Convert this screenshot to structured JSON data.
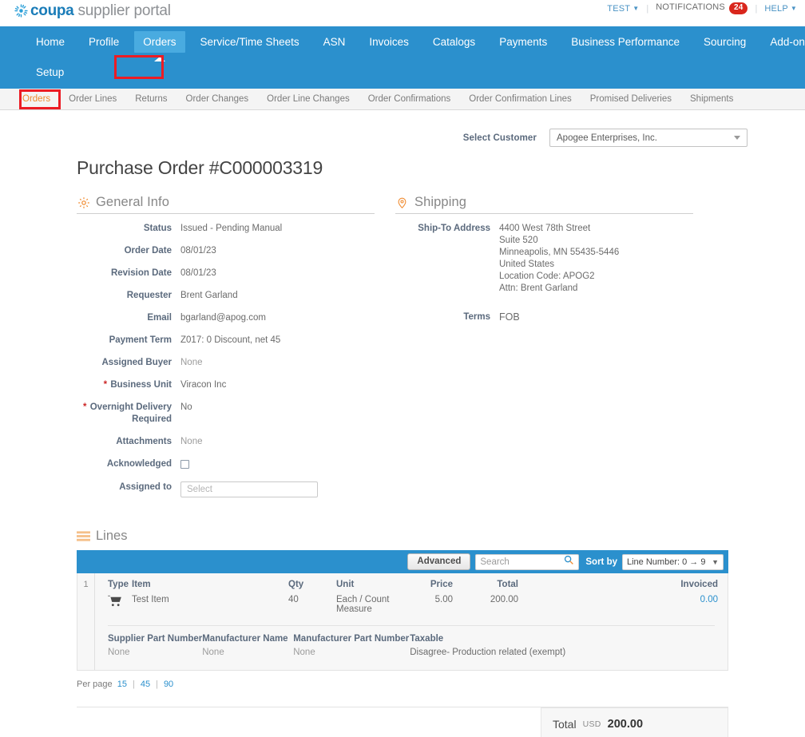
{
  "brand": {
    "logo_coupa": "coupa",
    "logo_supplier_portal": "supplier portal",
    "logo_icon": "coupa-starburst-icon",
    "accent_blue": "#2b90cd",
    "accent_orange": "#f08a2e",
    "badge_red": "#d9261c",
    "annotation_red": "#ec1c24"
  },
  "utility": {
    "test_label": "TEST",
    "notifications_label": "NOTIFICATIONS",
    "notifications_count": "24",
    "help_label": "HELP"
  },
  "mainnav": {
    "row1": [
      {
        "label": "Home",
        "active": false
      },
      {
        "label": "Profile",
        "active": false
      },
      {
        "label": "Orders",
        "active": true
      },
      {
        "label": "Service/Time Sheets",
        "active": false
      },
      {
        "label": "ASN",
        "active": false
      },
      {
        "label": "Invoices",
        "active": false
      },
      {
        "label": "Catalogs",
        "active": false
      },
      {
        "label": "Payments",
        "active": false
      },
      {
        "label": "Business Performance",
        "active": false
      },
      {
        "label": "Sourcing",
        "active": false
      },
      {
        "label": "Add-ons",
        "active": false
      }
    ],
    "row2": [
      {
        "label": "Setup",
        "active": false
      }
    ]
  },
  "subnav": [
    {
      "label": "Orders",
      "active": true
    },
    {
      "label": "Order Lines",
      "active": false
    },
    {
      "label": "Returns",
      "active": false
    },
    {
      "label": "Order Changes",
      "active": false
    },
    {
      "label": "Order Line Changes",
      "active": false
    },
    {
      "label": "Order Confirmations",
      "active": false
    },
    {
      "label": "Order Confirmation Lines",
      "active": false
    },
    {
      "label": "Promised Deliveries",
      "active": false
    },
    {
      "label": "Shipments",
      "active": false
    }
  ],
  "customer": {
    "label": "Select Customer",
    "selected": "Apogee Enterprises, Inc."
  },
  "page_title": "Purchase Order #C000003319",
  "general_info": {
    "heading": "General Info",
    "icon": "gear-icon",
    "fields": [
      {
        "label": "Status",
        "value": "Issued - Pending Manual",
        "required": false,
        "muted": false
      },
      {
        "label": "Order Date",
        "value": "08/01/23",
        "required": false,
        "muted": false
      },
      {
        "label": "Revision Date",
        "value": "08/01/23",
        "required": false,
        "muted": false
      },
      {
        "label": "Requester",
        "value": "Brent Garland",
        "required": false,
        "muted": false
      },
      {
        "label": "Email",
        "value": "bgarland@apog.com",
        "required": false,
        "muted": false
      },
      {
        "label": "Payment Term",
        "value": "Z017: 0 Discount, net 45",
        "required": false,
        "muted": false
      },
      {
        "label": "Assigned Buyer",
        "value": "None",
        "required": false,
        "muted": true
      },
      {
        "label": "Business Unit",
        "value": "Viracon Inc",
        "required": true,
        "muted": false
      },
      {
        "label": "Overnight Delivery Required",
        "value": "No",
        "required": true,
        "muted": false
      },
      {
        "label": "Attachments",
        "value": "None",
        "required": false,
        "muted": true
      }
    ],
    "acknowledged_label": "Acknowledged",
    "acknowledged_checked": false,
    "assigned_to_label": "Assigned to",
    "assigned_to_placeholder": "Select",
    "assigned_to_value": ""
  },
  "shipping": {
    "heading": "Shipping",
    "icon": "location-pin-icon",
    "ship_to_label": "Ship-To Address",
    "ship_to_lines": [
      "4400 West 78th Street",
      "Suite 520",
      "Minneapolis, MN 55435-5446",
      "United States",
      "Location Code: APOG2",
      "Attn: Brent Garland"
    ],
    "terms_label": "Terms",
    "terms_value": "FOB"
  },
  "lines": {
    "heading": "Lines",
    "icon": "lines-list-icon",
    "toolbar": {
      "advanced_label": "Advanced",
      "search_placeholder": "Search",
      "search_value": "",
      "search_icon": "magnifier-icon",
      "sort_by_label": "Sort by",
      "sort_selected": "Line Number: 0 → 9"
    },
    "columns": [
      "Type",
      "Item",
      "Qty",
      "Unit",
      "Price",
      "Total",
      "Invoiced"
    ],
    "rows": [
      {
        "number": "1",
        "type_icon": "shopping-cart-icon",
        "item": "Test Item",
        "qty": "40",
        "unit": "Each / Count Measure",
        "price": "5.00",
        "total": "200.00",
        "invoiced": "0.00"
      }
    ],
    "detail_columns": [
      "Supplier Part Number",
      "Manufacturer Name",
      "Manufacturer Part Number",
      "Taxable"
    ],
    "detail_values": [
      "None",
      "None",
      "None",
      "Disagree- Production related (exempt)"
    ],
    "per_page_label": "Per page",
    "per_page_options": [
      "15",
      "45",
      "90"
    ]
  },
  "footer": {
    "total_label": "Total",
    "currency": "USD",
    "amount": "200.00"
  }
}
